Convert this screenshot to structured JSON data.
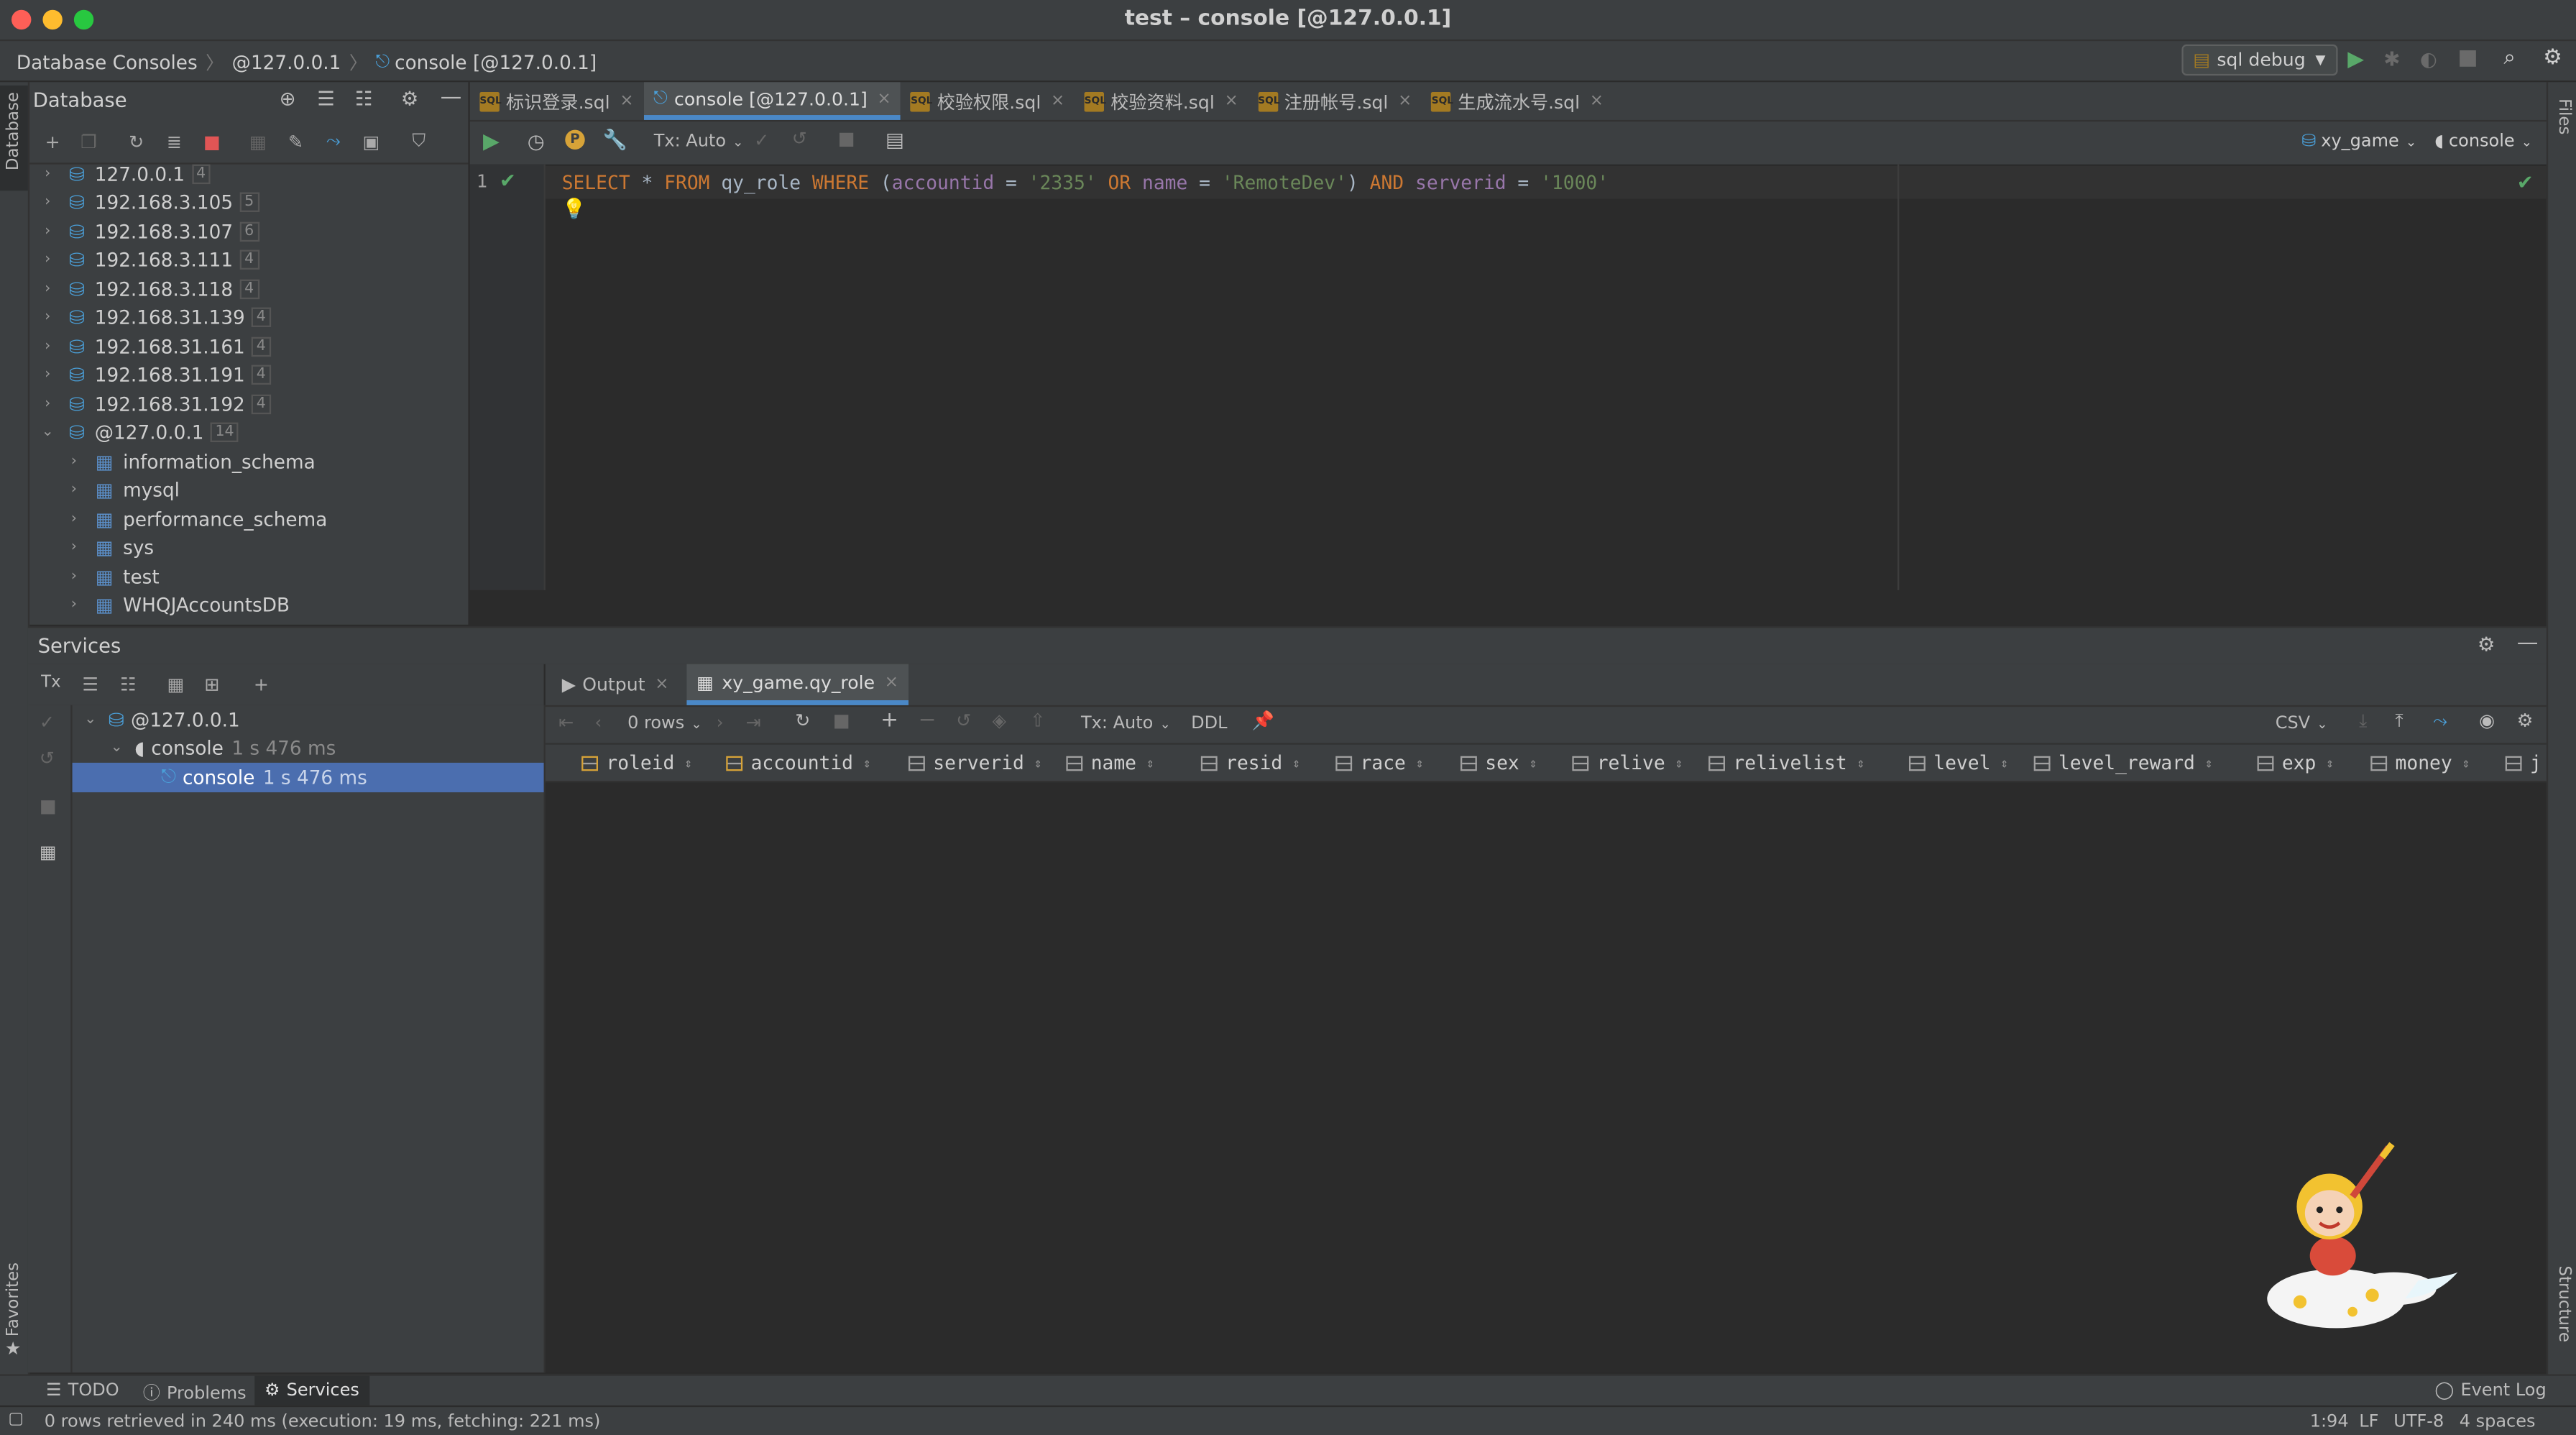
{
  "window": {
    "title": "test – console [@127.0.0.1]"
  },
  "breadcrumbs": [
    "Database Consoles",
    "@127.0.0.1",
    "console [@127.0.0.1]"
  ],
  "run_config": {
    "label": "sql debug"
  },
  "db_panel": {
    "title": "Database",
    "stripe_label": "Database",
    "tree": [
      {
        "label": "127.0.0.1",
        "count": "4",
        "expanded": false
      },
      {
        "label": "192.168.3.105",
        "count": "5",
        "expanded": false
      },
      {
        "label": "192.168.3.107",
        "count": "6",
        "expanded": false
      },
      {
        "label": "192.168.3.111",
        "count": "4",
        "expanded": false
      },
      {
        "label": "192.168.3.118",
        "count": "4",
        "expanded": false
      },
      {
        "label": "192.168.31.139",
        "count": "4",
        "expanded": false
      },
      {
        "label": "192.168.31.161",
        "count": "4",
        "expanded": false
      },
      {
        "label": "192.168.31.191",
        "count": "4",
        "expanded": false
      },
      {
        "label": "192.168.31.192",
        "count": "4",
        "expanded": false
      },
      {
        "label": "@127.0.0.1",
        "count": "14",
        "expanded": true
      }
    ],
    "schemas": [
      "information_schema",
      "mysql",
      "performance_schema",
      "sys",
      "test",
      "WHQJAccountsDB"
    ]
  },
  "editor_tabs": [
    {
      "label": "标识登录.sql",
      "active": false
    },
    {
      "label": "console [@127.0.0.1]",
      "active": true
    },
    {
      "label": "校验权限.sql",
      "active": false
    },
    {
      "label": "校验资料.sql",
      "active": false
    },
    {
      "label": "注册帐号.sql",
      "active": false
    },
    {
      "label": "生成流水号.sql",
      "active": false
    }
  ],
  "editor_toolbar": {
    "tx": "Tx: Auto",
    "schema": "xy_game",
    "session": "console"
  },
  "editor": {
    "line_number": "1",
    "tokens": [
      {
        "t": "SELECT",
        "c": "kw"
      },
      {
        "t": " * ",
        "c": "id"
      },
      {
        "t": "FROM",
        "c": "kw"
      },
      {
        "t": " qy_role ",
        "c": "id"
      },
      {
        "t": "WHERE",
        "c": "kw"
      },
      {
        "t": " (",
        "c": "id"
      },
      {
        "t": "accountid",
        "c": "fld"
      },
      {
        "t": " = ",
        "c": "id"
      },
      {
        "t": "'2335'",
        "c": "str"
      },
      {
        "t": " ",
        "c": "id"
      },
      {
        "t": "OR",
        "c": "kw"
      },
      {
        "t": " ",
        "c": "id"
      },
      {
        "t": "name",
        "c": "fld"
      },
      {
        "t": " = ",
        "c": "id"
      },
      {
        "t": "'RemoteDev'",
        "c": "str"
      },
      {
        "t": ") ",
        "c": "id"
      },
      {
        "t": "AND",
        "c": "kw"
      },
      {
        "t": " ",
        "c": "id"
      },
      {
        "t": "serverid",
        "c": "fld"
      },
      {
        "t": " = ",
        "c": "id"
      },
      {
        "t": "'1000'",
        "c": "str"
      }
    ]
  },
  "services": {
    "title": "Services",
    "tx_label": "Tx",
    "tree": [
      {
        "label": "@127.0.0.1",
        "time": ""
      },
      {
        "label": "console",
        "time": "1 s 476 ms"
      },
      {
        "label": "console",
        "time": "1 s 476 ms"
      }
    ],
    "result_tabs": [
      {
        "label": "Output"
      },
      {
        "label": "xy_game.qy_role"
      }
    ],
    "result_toolbar": {
      "rows": "0 rows",
      "tx": "Tx: Auto",
      "ddl": "DDL",
      "export": "CSV"
    },
    "columns": [
      "roleid",
      "accountid",
      "serverid",
      "name",
      "resid",
      "race",
      "sex",
      "relive",
      "relivelist",
      "level",
      "level_reward",
      "exp",
      "money",
      "j"
    ]
  },
  "bottom_tools": [
    {
      "label": "TODO"
    },
    {
      "label": "Problems"
    },
    {
      "label": "Services"
    }
  ],
  "event_log": "Event Log",
  "status": {
    "message": "0 rows retrieved in 240 ms (execution: 19 ms, fetching: 221 ms)",
    "position": "1:94",
    "line_sep": "LF",
    "encoding": "UTF-8",
    "indent": "4 spaces"
  },
  "side_stripes": {
    "favorites": "Favorites",
    "structure": "Structure",
    "files": "Files"
  }
}
